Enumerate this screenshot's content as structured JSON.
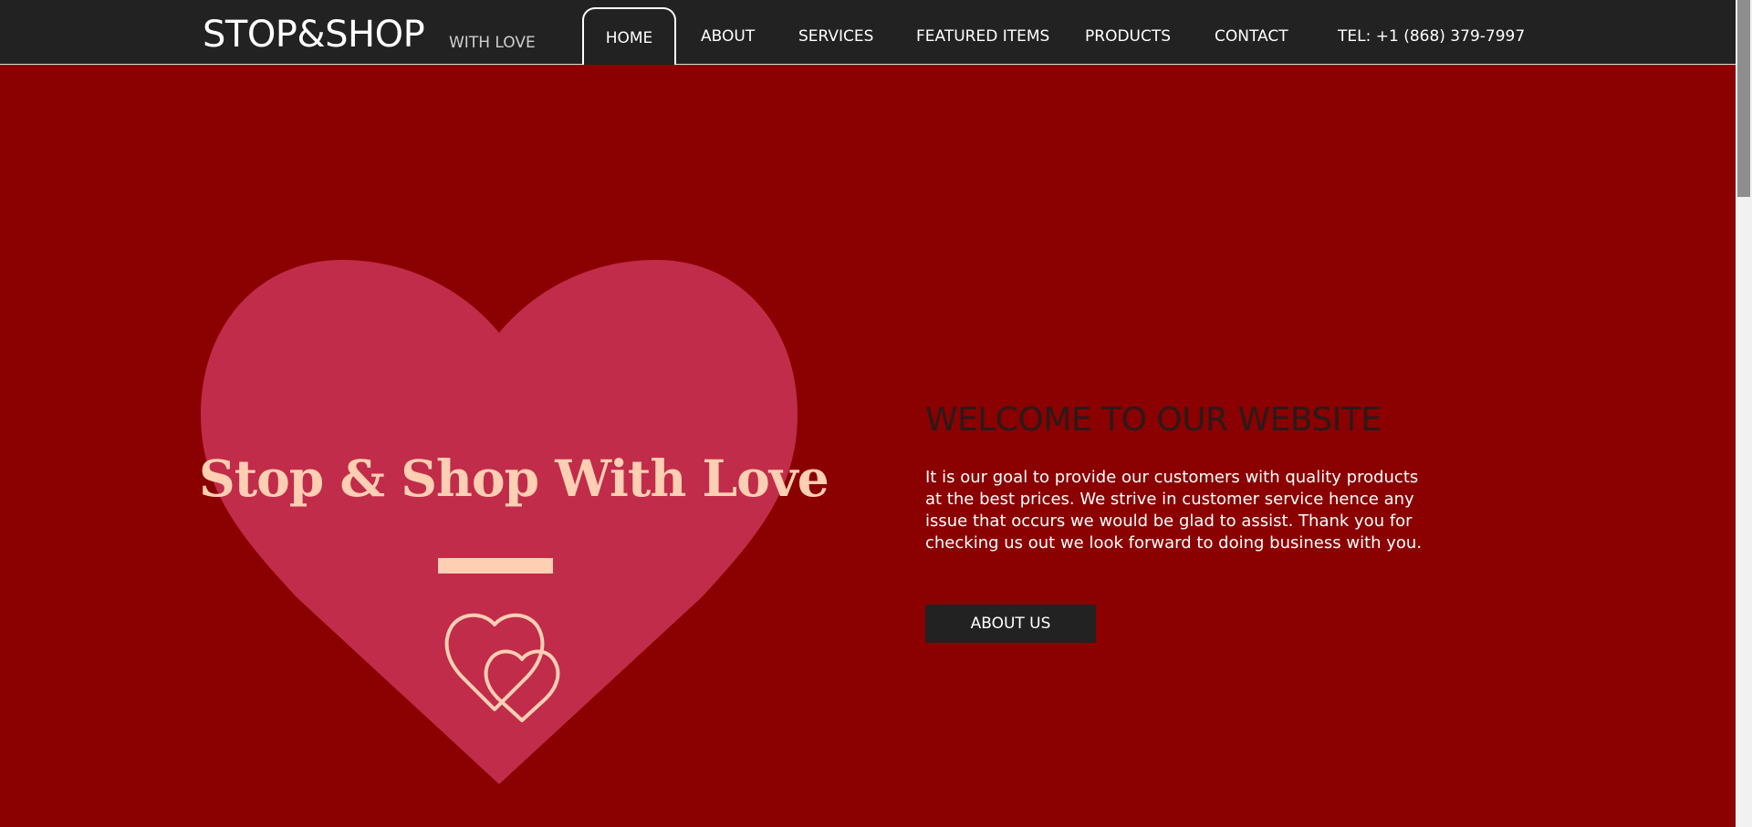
{
  "header": {
    "brand": "STOP&SHOP",
    "tagline": "WITH LOVE"
  },
  "nav": {
    "items": [
      {
        "label": "HOME",
        "active": true
      },
      {
        "label": "ABOUT"
      },
      {
        "label": "SERVICES"
      },
      {
        "label": "FEATURED ITEMS"
      },
      {
        "label": "PRODUCTS"
      },
      {
        "label": "CONTACT"
      }
    ],
    "phone": "TEL: +1 (868) 379-7997"
  },
  "hero": {
    "logo_text": "Stop & Shop With Love",
    "logo_icon": "double-hearts-icon",
    "title": "WELCOME TO OUR WEBSITE",
    "body": "It is our goal to provide our customers with quality products at the best prices. We strive in customer service hence any issue that occurs we would be glad to assist. Thank you for checking us out we look forward to doing business with you.",
    "button_label": "ABOUT US"
  },
  "colors": {
    "background": "#8b0000",
    "header": "#222222",
    "heart": "#c12c4a",
    "logo_accent": "#ffcfb3",
    "button": "#222222"
  }
}
